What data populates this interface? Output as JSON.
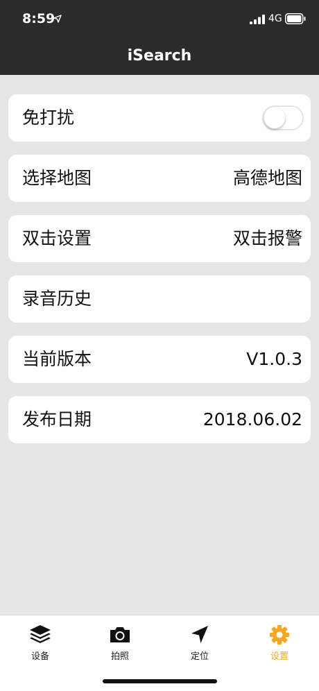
{
  "status_bar": {
    "time": "8:59",
    "network": "4G"
  },
  "nav": {
    "title": "iSearch"
  },
  "settings": {
    "do_not_disturb": {
      "label": "免打扰",
      "enabled": false
    },
    "map_select": {
      "label": "选择地图",
      "value": "高德地图"
    },
    "double_tap": {
      "label": "双击设置",
      "value": "双击报警"
    },
    "recording_history": {
      "label": "录音历史"
    },
    "current_version": {
      "label": "当前版本",
      "value": "V1.0.3"
    },
    "release_date": {
      "label": "发布日期",
      "value": "2018.06.02"
    }
  },
  "tabs": [
    {
      "label": "设备",
      "icon": "layers-icon"
    },
    {
      "label": "拍照",
      "icon": "camera-icon"
    },
    {
      "label": "定位",
      "icon": "location-arrow-icon"
    },
    {
      "label": "设置",
      "icon": "gear-icon",
      "active": true
    }
  ],
  "colors": {
    "header_bg": "#2b2b2b",
    "page_bg": "#e6e6e6",
    "accent": "#f5a623"
  }
}
